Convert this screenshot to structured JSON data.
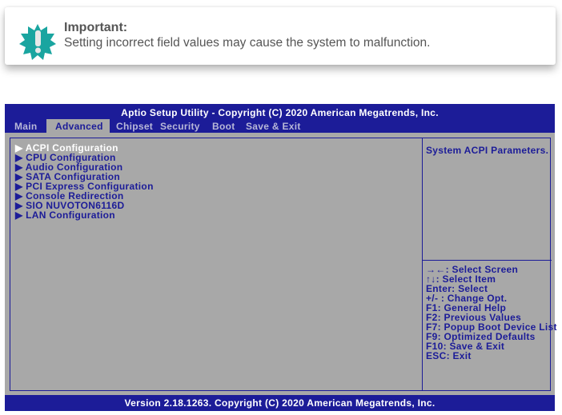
{
  "notice": {
    "title": "Important:",
    "text": "Setting incorrect field values may cause the system to malfunction.",
    "icon": "warning-badge-icon",
    "accent": "#1aa5a0"
  },
  "bios": {
    "title": "Aptio Setup Utility - Copyright (C) 2020 American Megatrends, Inc.",
    "tabs": [
      {
        "label": "Main"
      },
      {
        "label": "Advanced"
      },
      {
        "label": "Chipset"
      },
      {
        "label": "Security"
      },
      {
        "label": "Boot"
      },
      {
        "label": "Save & Exit"
      }
    ],
    "active_tab": "Advanced",
    "menu": [
      {
        "label": "ACPI Configuration"
      },
      {
        "label": "CPU Configuration"
      },
      {
        "label": "Audio Configuration"
      },
      {
        "label": "SATA Configuration"
      },
      {
        "label": "PCI Express Configuration"
      },
      {
        "label": "Console Redirection"
      },
      {
        "label": "SIO NUVOTON6116D"
      },
      {
        "label": "LAN Configuration"
      }
    ],
    "arrow": "▶",
    "help": "System ACPI Parameters.",
    "keys": [
      "→←: Select Screen",
      "↑↓: Select Item",
      "Enter: Select",
      "+/- : Change Opt.",
      "F1: General Help",
      "F2: Previous Values",
      "F7: Popup Boot Device List",
      "F9: Optimized Defaults",
      "F10: Save & Exit",
      "ESC: Exit"
    ],
    "footer": "Version 2.18.1263. Copyright (C) 2020 American Megatrends, Inc.",
    "colors": {
      "blue": "#1c1c98",
      "gray": "#a8a8a8"
    }
  }
}
